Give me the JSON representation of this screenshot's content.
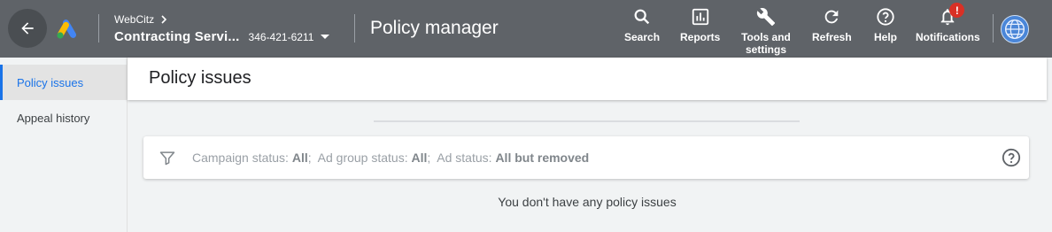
{
  "header": {
    "account_parent": "WebCitz",
    "account_name": "Contracting Servi...",
    "account_id": "346-421-6211",
    "page_title": "Policy manager",
    "tools": [
      {
        "label": "Search",
        "icon": "search-icon"
      },
      {
        "label": "Reports",
        "icon": "reports-icon"
      },
      {
        "label": "Tools and settings",
        "icon": "wrench-icon"
      },
      {
        "label": "Refresh",
        "icon": "refresh-icon"
      },
      {
        "label": "Help",
        "icon": "help-icon"
      },
      {
        "label": "Notifications",
        "icon": "bell-icon"
      }
    ],
    "notifications_badge": "!",
    "colors": {
      "bar": "#5f6368",
      "badge": "#d93025"
    }
  },
  "sidebar": {
    "items": [
      {
        "label": "Policy issues",
        "active": true
      },
      {
        "label": "Appeal history",
        "active": false
      }
    ],
    "accent": "#1a73e8"
  },
  "main": {
    "title": "Policy issues",
    "filter": {
      "campaign_label": "Campaign status:",
      "campaign_value": "All",
      "adgroup_label": "Ad group status:",
      "adgroup_value": "All",
      "ad_label": "Ad status:",
      "ad_value": "All but removed"
    },
    "empty_message": "You don't have any policy issues"
  }
}
